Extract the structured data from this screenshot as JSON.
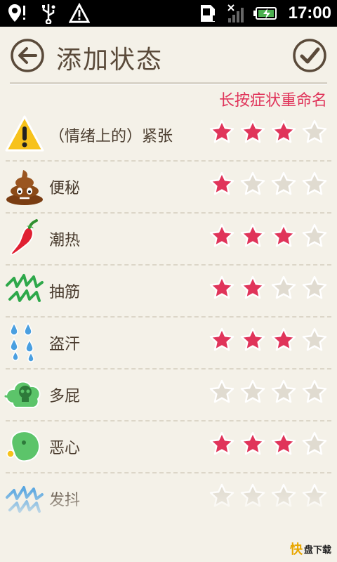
{
  "status_bar": {
    "time": "17:00",
    "icons": [
      "location-pin-icon",
      "usb-icon",
      "warning-icon",
      "sd-card-icon",
      "signal-icon",
      "battery-charging-icon"
    ]
  },
  "header": {
    "title": "添加状态",
    "back_icon": "back-arrow-icon",
    "confirm_icon": "checkmark-icon"
  },
  "hint": "长按症状重命名",
  "colors": {
    "accent": "#e0345a",
    "star_active": "#e0345a",
    "star_inactive": "#e0dbd0",
    "title_text": "#5a4a3a"
  },
  "symptoms": [
    {
      "label": "（情绪上的）紧张",
      "icon": "warning-sign-icon",
      "rating": 3,
      "max": 4
    },
    {
      "label": "便秘",
      "icon": "poop-icon",
      "rating": 1,
      "max": 4
    },
    {
      "label": "潮热",
      "icon": "chili-pepper-icon",
      "rating": 3,
      "max": 4
    },
    {
      "label": "抽筋",
      "icon": "cramp-zigzag-icon",
      "rating": 2,
      "max": 4
    },
    {
      "label": "盗汗",
      "icon": "sweat-drops-icon",
      "rating": 3,
      "max": 4
    },
    {
      "label": "多屁",
      "icon": "gas-cloud-icon",
      "rating": 0,
      "max": 4
    },
    {
      "label": "恶心",
      "icon": "nausea-face-icon",
      "rating": 3,
      "max": 4
    },
    {
      "label": "发抖",
      "icon": "shiver-zigzag-icon",
      "rating": 0,
      "max": 4
    }
  ],
  "watermark": {
    "k": "快",
    "text": "盘下载"
  }
}
